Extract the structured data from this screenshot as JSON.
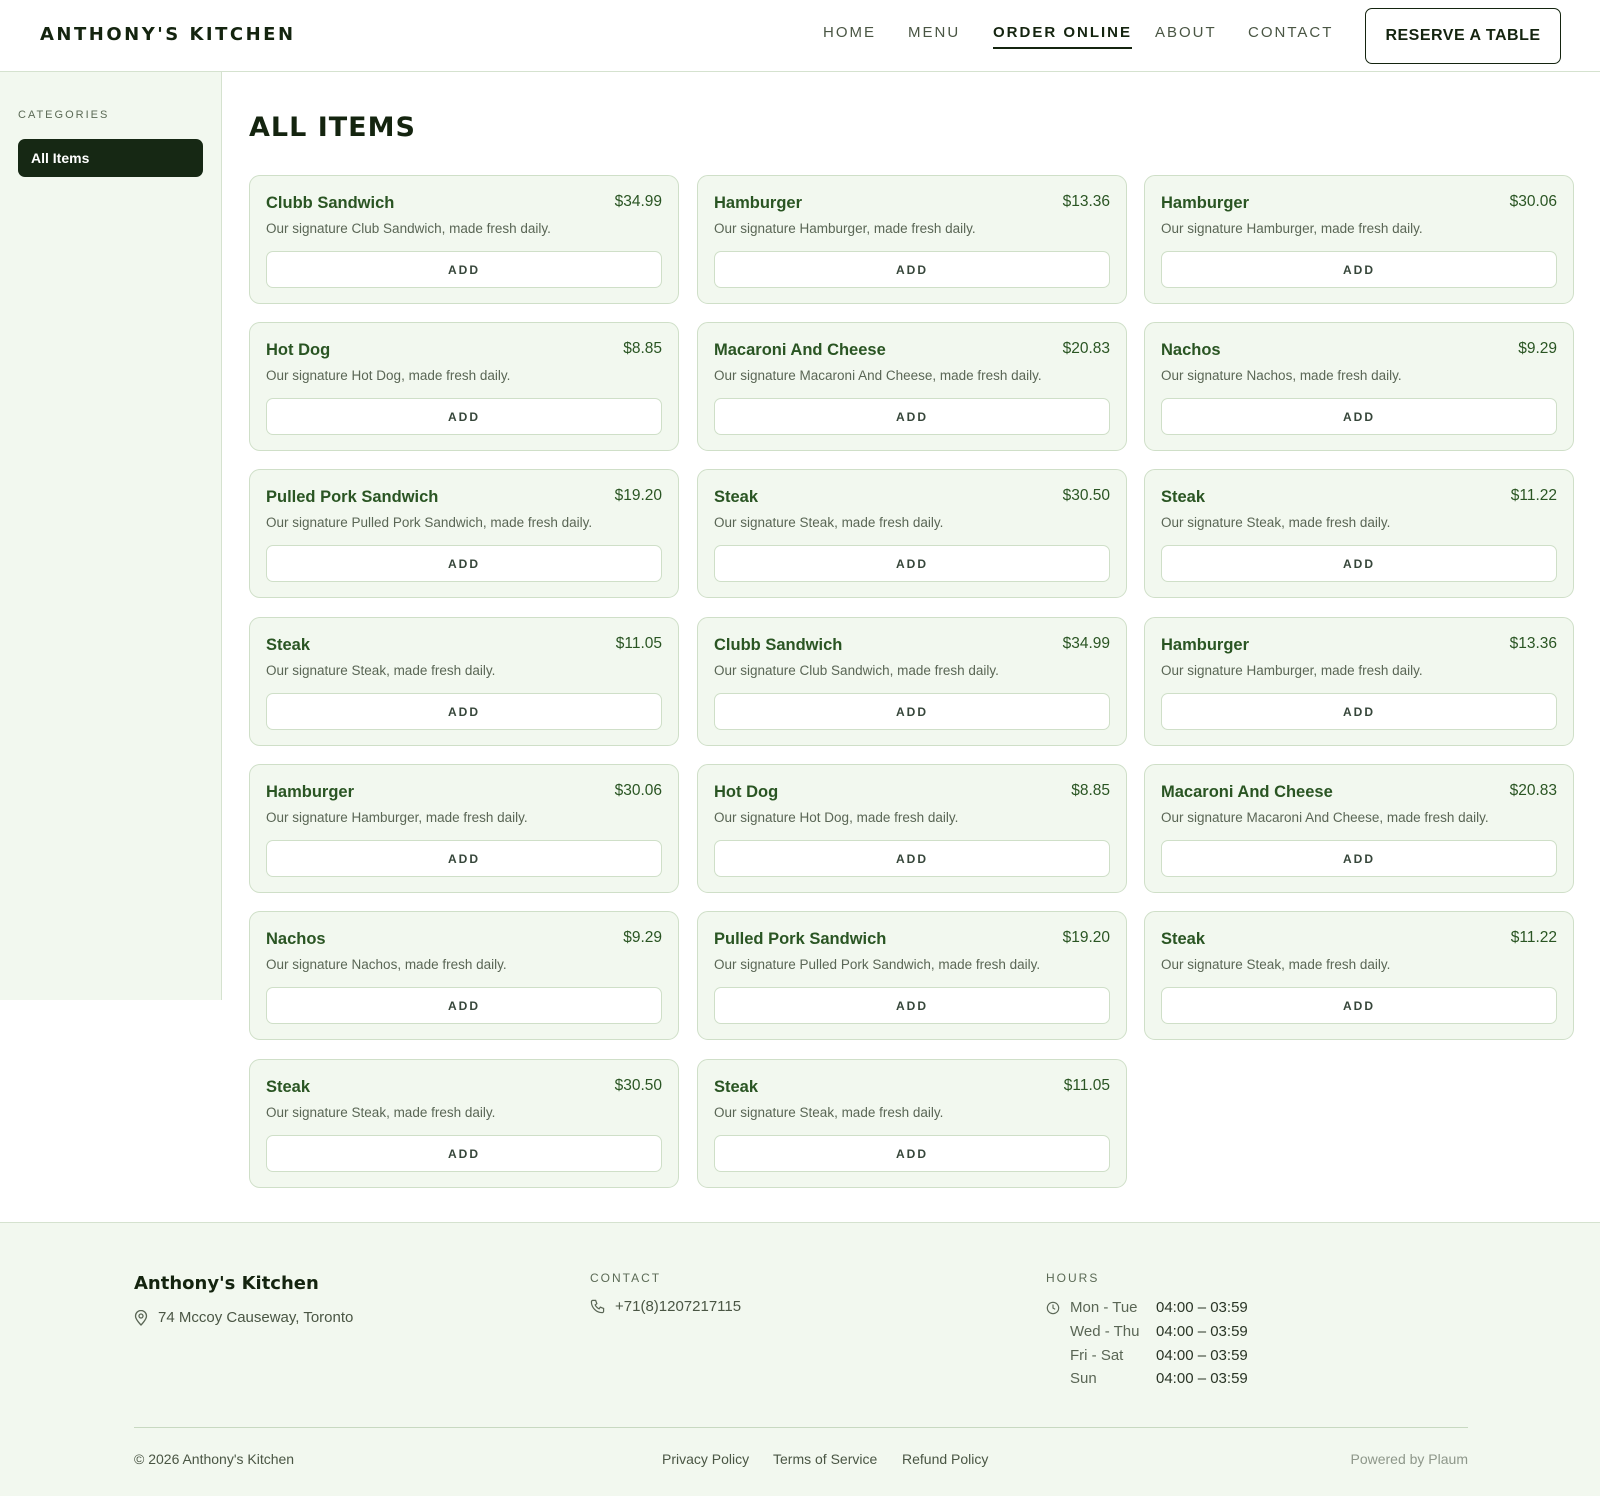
{
  "header": {
    "brand": "ANTHONY'S KITCHEN",
    "nav": [
      "HOME",
      "MENU",
      "ORDER ONLINE",
      "ABOUT",
      "CONTACT"
    ],
    "active_nav": "ORDER ONLINE",
    "reserve_label": "RESERVE A TABLE"
  },
  "sidebar": {
    "title": "CATEGORIES",
    "items": [
      {
        "label": "All Items",
        "active": true
      }
    ]
  },
  "main": {
    "title": "ALL ITEMS",
    "add_label": "ADD",
    "items": [
      {
        "name": "Clubb Sandwich",
        "price": "$34.99",
        "desc": "Our signature Club Sandwich, made fresh daily."
      },
      {
        "name": "Hamburger",
        "price": "$13.36",
        "desc": "Our signature Hamburger, made fresh daily."
      },
      {
        "name": "Hamburger",
        "price": "$30.06",
        "desc": "Our signature Hamburger, made fresh daily."
      },
      {
        "name": "Hot Dog",
        "price": "$8.85",
        "desc": "Our signature Hot Dog, made fresh daily."
      },
      {
        "name": "Macaroni And Cheese",
        "price": "$20.83",
        "desc": "Our signature Macaroni And Cheese, made fresh daily."
      },
      {
        "name": "Nachos",
        "price": "$9.29",
        "desc": "Our signature Nachos, made fresh daily."
      },
      {
        "name": "Pulled Pork Sandwich",
        "price": "$19.20",
        "desc": "Our signature Pulled Pork Sandwich, made fresh daily."
      },
      {
        "name": "Steak",
        "price": "$30.50",
        "desc": "Our signature Steak, made fresh daily."
      },
      {
        "name": "Steak",
        "price": "$11.22",
        "desc": "Our signature Steak, made fresh daily."
      },
      {
        "name": "Steak",
        "price": "$11.05",
        "desc": "Our signature Steak, made fresh daily."
      },
      {
        "name": "Clubb Sandwich",
        "price": "$34.99",
        "desc": "Our signature Club Sandwich, made fresh daily."
      },
      {
        "name": "Hamburger",
        "price": "$13.36",
        "desc": "Our signature Hamburger, made fresh daily."
      },
      {
        "name": "Hamburger",
        "price": "$30.06",
        "desc": "Our signature Hamburger, made fresh daily."
      },
      {
        "name": "Hot Dog",
        "price": "$8.85",
        "desc": "Our signature Hot Dog, made fresh daily."
      },
      {
        "name": "Macaroni And Cheese",
        "price": "$20.83",
        "desc": "Our signature Macaroni And Cheese, made fresh daily."
      },
      {
        "name": "Nachos",
        "price": "$9.29",
        "desc": "Our signature Nachos, made fresh daily."
      },
      {
        "name": "Pulled Pork Sandwich",
        "price": "$19.20",
        "desc": "Our signature Pulled Pork Sandwich, made fresh daily."
      },
      {
        "name": "Steak",
        "price": "$11.22",
        "desc": "Our signature Steak, made fresh daily."
      },
      {
        "name": "Steak",
        "price": "$30.50",
        "desc": "Our signature Steak, made fresh daily."
      },
      {
        "name": "Steak",
        "price": "$11.05",
        "desc": "Our signature Steak, made fresh daily."
      }
    ]
  },
  "footer": {
    "brand": "Anthony's Kitchen",
    "address": "74 Mccoy Causeway, Toronto",
    "contact_label": "CONTACT",
    "phone": "+71(8)1207217115",
    "hours_label": "HOURS",
    "hours": [
      {
        "days": "Mon - Tue",
        "time": "04:00 – 03:59"
      },
      {
        "days": "Wed - Thu",
        "time": "04:00 – 03:59"
      },
      {
        "days": "Fri - Sat",
        "time": "04:00 – 03:59"
      },
      {
        "days": "Sun",
        "time": "04:00 – 03:59"
      }
    ],
    "copyright": "© 2026 Anthony's Kitchen",
    "links": [
      "Privacy Policy",
      "Terms of Service",
      "Refund Policy"
    ],
    "powered": "Powered by Plaum"
  },
  "colors": {
    "accent_dark": "#14240f",
    "item_green": "#2a5523",
    "panel_bg": "#f2f8ef",
    "border": "#cfdfc8"
  },
  "icons": {
    "address": "map-pin-icon",
    "phone": "phone-icon",
    "hours": "clock-icon"
  }
}
